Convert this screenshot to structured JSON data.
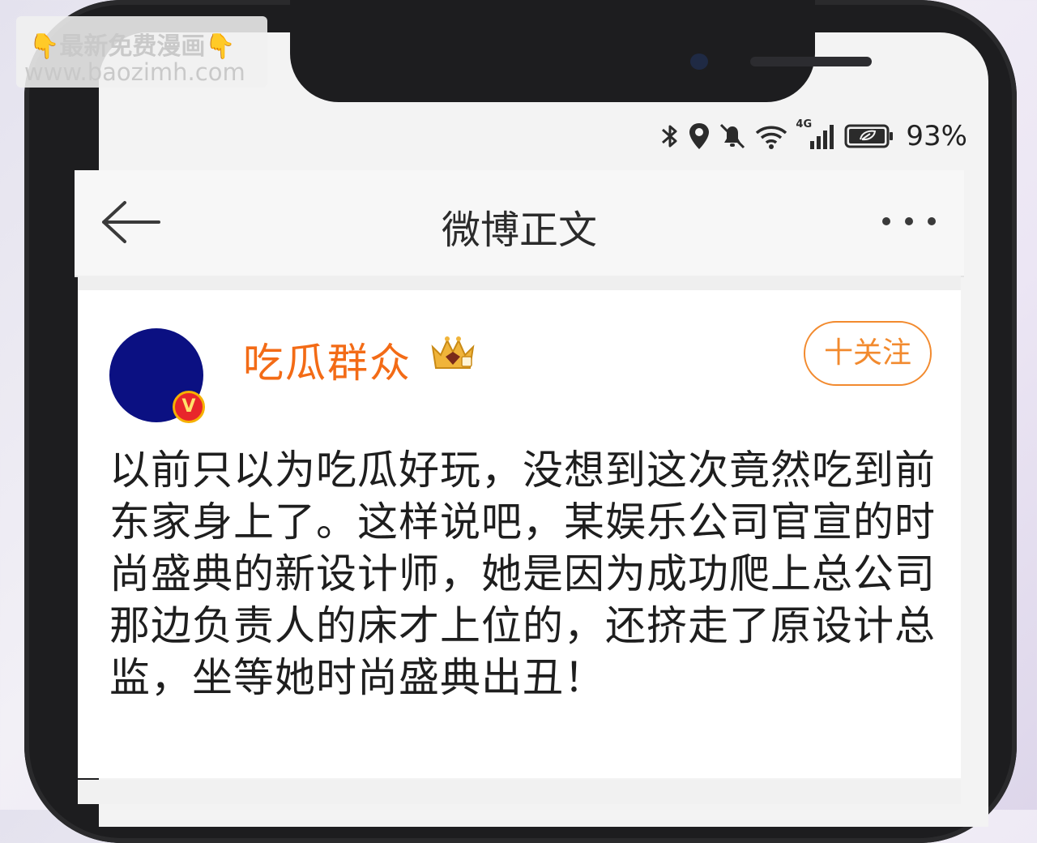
{
  "watermark": {
    "line1": "最新免费漫画",
    "line2": "www.baozimh.com",
    "hand_emoji": "👇"
  },
  "status_bar": {
    "icons": [
      "bluetooth-icon",
      "location-icon",
      "mute-icon",
      "wifi-icon",
      "4g-signal-icon",
      "battery-icon"
    ],
    "network_label": "4G",
    "battery_percent": "93%"
  },
  "nav": {
    "title": "微博正文",
    "back_icon": "arrow-left-icon",
    "more_icon": "more-dots-icon"
  },
  "post": {
    "user_name": "吃瓜群众",
    "verified_mark": "V",
    "follow_label": "十关注",
    "text": "以前只以为吃瓜好玩，没想到这次竟然吃到前东家身上了。这样说吧，某娱乐公司官宣的时尚盛典的新设计师，她是因为成功爬上总公司那边负责人的床才上位的，还挤走了原设计总监，坐等她时尚盛典出丑！"
  },
  "colors": {
    "accent_orange": "#f36b16",
    "follow_orange": "#f28a2e",
    "avatar_blue": "#0b1082",
    "badge_red": "#e8262b"
  }
}
